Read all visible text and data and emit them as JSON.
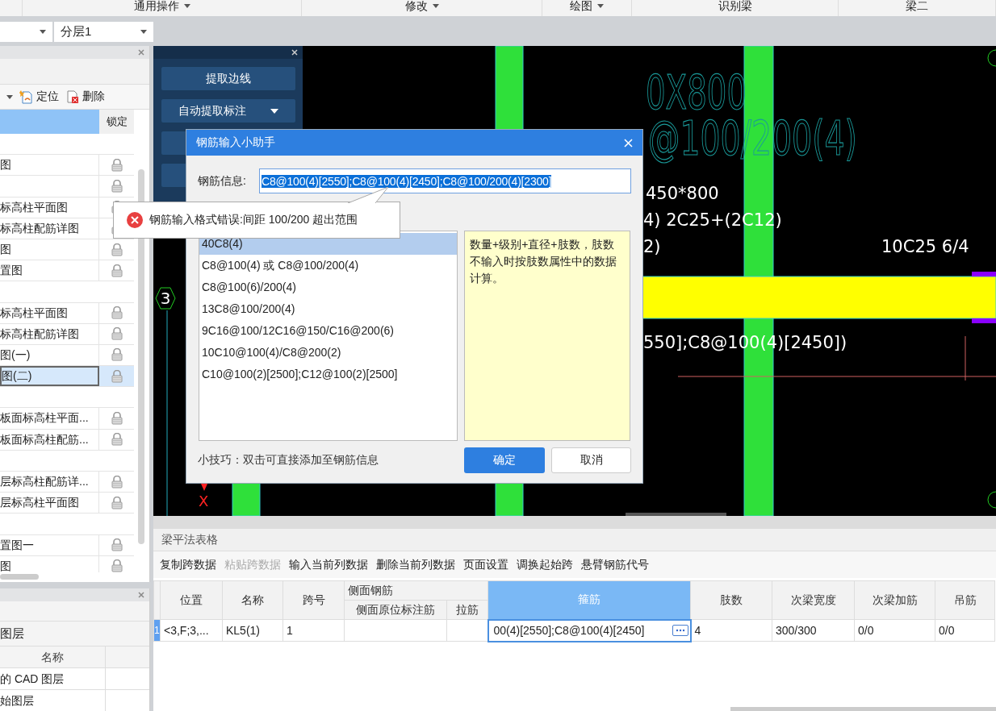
{
  "ribbon": {
    "groups": [
      {
        "label": "通用操作",
        "dropdown": true
      },
      {
        "label": "修改",
        "dropdown": true
      },
      {
        "label": "绘图",
        "dropdown": true
      },
      {
        "label": "识别梁",
        "dropdown": false
      },
      {
        "label": "梁二",
        "dropdown": false
      }
    ]
  },
  "floor_bar": {
    "layer": "分层1"
  },
  "drawing_list": {
    "toolbar": [
      "定位",
      "删除"
    ],
    "lock_column": "锁定",
    "rows": [
      {
        "kind": "group",
        "selected": false
      },
      {
        "kind": "file",
        "text": "图",
        "locked": true,
        "selected": false
      },
      {
        "kind": "file",
        "locked": true,
        "selected": false
      },
      {
        "kind": "file",
        "text": "标高柱平面图",
        "locked": true,
        "selected": false
      },
      {
        "kind": "file",
        "text": "标高柱配筋详图",
        "locked": true,
        "selected": false
      },
      {
        "kind": "file",
        "text": "图",
        "locked": true,
        "selected": false
      },
      {
        "kind": "file",
        "text": "置图",
        "locked": true,
        "selected": false
      },
      {
        "kind": "group",
        "selected": false
      },
      {
        "kind": "file",
        "text": "标高柱平面图",
        "locked": true,
        "selected": false
      },
      {
        "kind": "file",
        "text": "标高柱配筋详图",
        "locked": true,
        "selected": false
      },
      {
        "kind": "file",
        "text": "图(一)",
        "locked": true,
        "selected": false
      },
      {
        "kind": "file",
        "text": "图(二)",
        "locked": true,
        "selected": true
      },
      {
        "kind": "group",
        "selected": false
      },
      {
        "kind": "file",
        "text": "板面标高柱平面...",
        "locked": true,
        "selected": false
      },
      {
        "kind": "file",
        "text": "板面标高柱配筋...",
        "locked": true,
        "selected": false
      },
      {
        "kind": "group",
        "selected": false
      },
      {
        "kind": "file",
        "text": "层标高柱配筋详...",
        "locked": true,
        "selected": false
      },
      {
        "kind": "file",
        "text": "层标高柱平面图",
        "locked": true,
        "selected": false
      },
      {
        "kind": "group",
        "selected": false
      },
      {
        "kind": "file",
        "text": "置图一",
        "locked": true,
        "selected": false
      },
      {
        "kind": "file",
        "text": "图",
        "locked": true,
        "selected": false
      }
    ]
  },
  "layer_panel": {
    "title": "图层",
    "column": "名称",
    "rows": [
      "的 CAD 图层",
      "始图层"
    ]
  },
  "cad_panel": {
    "buttons": [
      {
        "label": "提取边线",
        "dropdown": false
      },
      {
        "label": "自动提取标注",
        "dropdown": true
      }
    ]
  },
  "canvas": {
    "axis_label": "3",
    "texts": [
      {
        "kind": "big",
        "text": "0X800"
      },
      {
        "kind": "big",
        "text": "@100/200(4)"
      },
      {
        "kind": "note",
        "text": "450*800"
      },
      {
        "kind": "note",
        "text": "4) 2C25+(2C12)"
      },
      {
        "kind": "note",
        "text": "2)"
      },
      {
        "kind": "note",
        "text": "10C25 6/4"
      },
      {
        "kind": "note",
        "text": "550];C8@100(4)[2450])"
      },
      {
        "kind": "marker",
        "text": "X"
      }
    ]
  },
  "dialog": {
    "title": "钢筋输入小助手",
    "field_label": "钢筋信息:",
    "value": "C8@100(4)[2550];C8@100(4)[2450];C8@100/200(4)[2300]",
    "error": "钢筋输入格式错误:间距 100/200 超出范围",
    "examples": [
      {
        "text": "40C8(4)",
        "selected": true
      },
      {
        "text": "C8@100(4) 或 C8@100/200(4)",
        "selected": false
      },
      {
        "text": "C8@100(6)/200(4)",
        "selected": false
      },
      {
        "text": "13C8@100/200(4)",
        "selected": false
      },
      {
        "text": "9C16@100/12C16@150/C16@200(6)",
        "selected": false
      },
      {
        "text": "10C10@100(4)/C8@200(2)",
        "selected": false
      },
      {
        "text": "C10@100(2)[2500];C12@100(2)[2500]",
        "selected": false
      }
    ],
    "hint": "数量+级别+直径+肢数，肢数不输入时按肢数属性中的数据计算。",
    "tip": "小技巧：双击可直接添加至钢筋信息",
    "ok": "确定",
    "cancel": "取消"
  },
  "beam_table": {
    "title": "梁平法表格",
    "toolbar": [
      {
        "label": "复制跨数据",
        "disabled": false
      },
      {
        "label": "粘贴跨数据",
        "disabled": true
      },
      {
        "label": "输入当前列数据",
        "disabled": false
      },
      {
        "label": "删除当前列数据",
        "disabled": false
      },
      {
        "label": "页面设置",
        "disabled": false
      },
      {
        "label": "调换起始跨",
        "disabled": false
      },
      {
        "label": "悬臂钢筋代号",
        "disabled": false
      }
    ],
    "group_header": "侧面钢筋",
    "columns": [
      {
        "label": "位置",
        "selected": false
      },
      {
        "label": "名称",
        "selected": false
      },
      {
        "label": "跨号",
        "selected": false
      },
      {
        "label": "侧面原位标注筋",
        "selected": false
      },
      {
        "label": "拉筋",
        "selected": false
      },
      {
        "label": "箍筋",
        "selected": true
      },
      {
        "label": "肢数",
        "selected": false
      },
      {
        "label": "次梁宽度",
        "selected": false
      },
      {
        "label": "次梁加筋",
        "selected": false
      },
      {
        "label": "吊筋",
        "selected": false
      }
    ],
    "rows": [
      {
        "index": "1",
        "cells": [
          "<3,F;3,...",
          "KL5(1)",
          "1",
          "",
          "",
          "00(4)[2550];C8@100(4)[2450]",
          "4",
          "300/300",
          "0/0",
          "0/0"
        ]
      }
    ]
  }
}
